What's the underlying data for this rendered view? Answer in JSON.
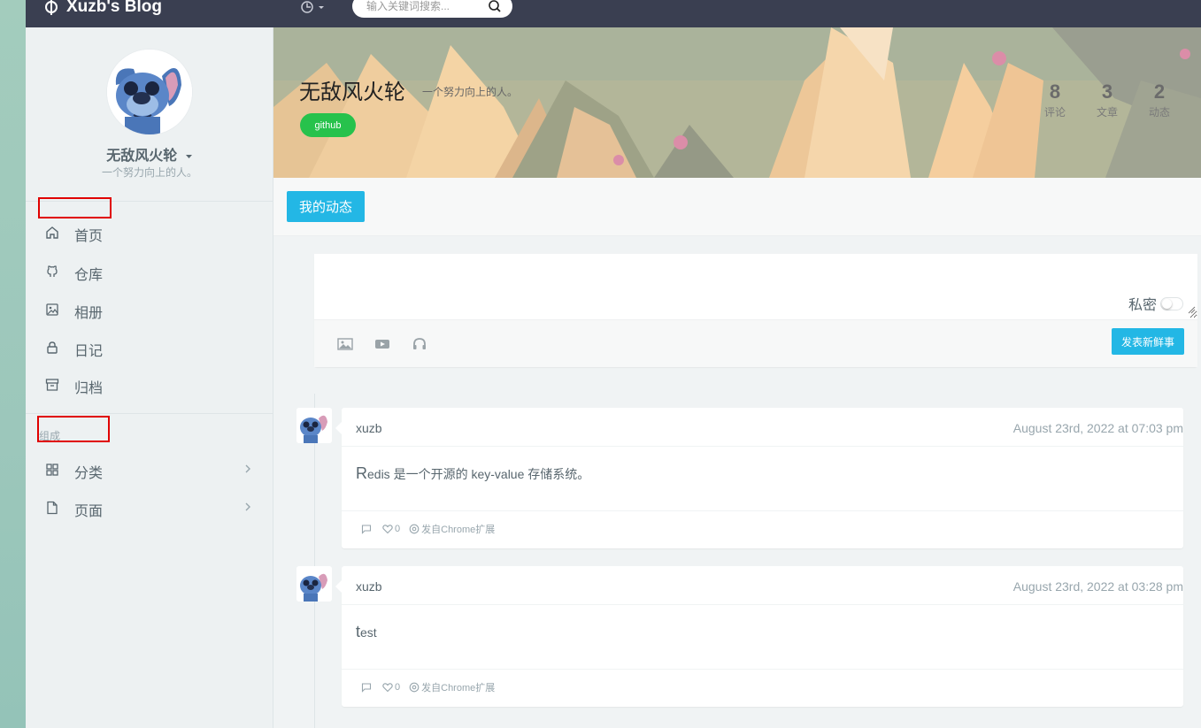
{
  "header": {
    "brand": "Xuzb's Blog",
    "search_placeholder": "输入关键词搜索..."
  },
  "sidebar": {
    "profile_name": "无敌风火轮",
    "profile_motto": "一个努力向上的人。",
    "items": [
      {
        "label": "首页",
        "icon": "home-icon"
      },
      {
        "label": "仓库",
        "icon": "github-icon"
      },
      {
        "label": "相册",
        "icon": "image-icon"
      },
      {
        "label": "日记",
        "icon": "lock-icon"
      },
      {
        "label": "归档",
        "icon": "archive-icon"
      }
    ],
    "section_label": "组成",
    "section_items": [
      {
        "label": "分类",
        "icon": "grid-icon"
      },
      {
        "label": "页面",
        "icon": "file-icon"
      }
    ]
  },
  "banner": {
    "title": "无敌风火轮",
    "subtitle": "一个努力向上的人。",
    "github_label": "github",
    "stats": [
      {
        "num": "8",
        "label": "评论"
      },
      {
        "num": "3",
        "label": "文章"
      },
      {
        "num": "2",
        "label": "动态"
      }
    ]
  },
  "tabs": {
    "active": "我的动态"
  },
  "composer": {
    "private_label": "私密",
    "private_on": false,
    "post_button": "发表新鲜事"
  },
  "feed": [
    {
      "author": "xuzb",
      "time": "August 23rd, 2022 at 07:03 pm",
      "text_first": "R",
      "text_rest": "edis 是一个开源的 key-value 存储系统。",
      "likes": "0",
      "source": "发自Chrome扩展"
    },
    {
      "author": "xuzb",
      "time": "August 23rd, 2022 at 03:28 pm",
      "text_first": "t",
      "text_rest": "est",
      "likes": "0",
      "source": "发自Chrome扩展"
    }
  ],
  "colors": {
    "accent": "#23b7e5",
    "github": "#27c24c",
    "topbar": "#3a3f51"
  }
}
